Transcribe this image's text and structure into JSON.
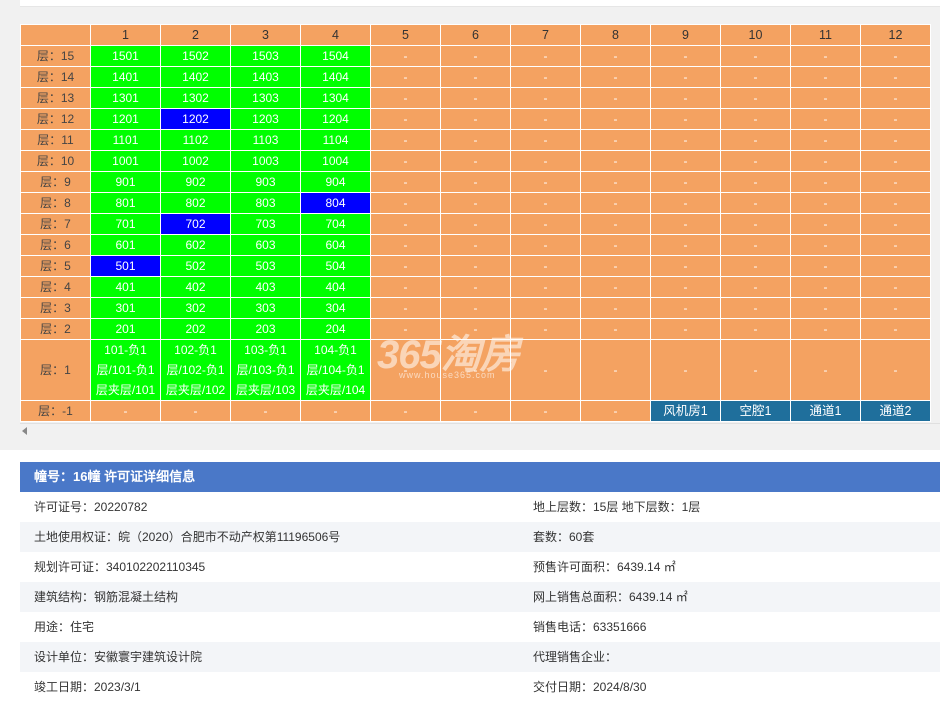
{
  "colors": {
    "available": "#00ff00",
    "sold": "#f4a261",
    "header": "#f4a261",
    "selected": "#0000ff",
    "special": "#1f6f9c",
    "detail_header": "#4a78c8"
  },
  "table": {
    "columns": [
      "1",
      "2",
      "3",
      "4",
      "5",
      "6",
      "7",
      "8",
      "9",
      "10",
      "11",
      "12"
    ],
    "rows": [
      {
        "floor": "层：15",
        "cells": [
          {
            "t": "1501",
            "s": "a"
          },
          {
            "t": "1502",
            "s": "a"
          },
          {
            "t": "1503",
            "s": "a"
          },
          {
            "t": "1504",
            "s": "a"
          },
          {
            "t": "-",
            "s": "n"
          },
          {
            "t": "-",
            "s": "n"
          },
          {
            "t": "-",
            "s": "n"
          },
          {
            "t": "-",
            "s": "n"
          },
          {
            "t": "-",
            "s": "n"
          },
          {
            "t": "-",
            "s": "n"
          },
          {
            "t": "-",
            "s": "n"
          },
          {
            "t": "-",
            "s": "n"
          }
        ]
      },
      {
        "floor": "层：14",
        "cells": [
          {
            "t": "1401",
            "s": "a"
          },
          {
            "t": "1402",
            "s": "a"
          },
          {
            "t": "1403",
            "s": "a"
          },
          {
            "t": "1404",
            "s": "a"
          },
          {
            "t": "-",
            "s": "n"
          },
          {
            "t": "-",
            "s": "n"
          },
          {
            "t": "-",
            "s": "n"
          },
          {
            "t": "-",
            "s": "n"
          },
          {
            "t": "-",
            "s": "n"
          },
          {
            "t": "-",
            "s": "n"
          },
          {
            "t": "-",
            "s": "n"
          },
          {
            "t": "-",
            "s": "n"
          }
        ]
      },
      {
        "floor": "层：13",
        "cells": [
          {
            "t": "1301",
            "s": "a"
          },
          {
            "t": "1302",
            "s": "a"
          },
          {
            "t": "1303",
            "s": "a"
          },
          {
            "t": "1304",
            "s": "a"
          },
          {
            "t": "-",
            "s": "n"
          },
          {
            "t": "-",
            "s": "n"
          },
          {
            "t": "-",
            "s": "n"
          },
          {
            "t": "-",
            "s": "n"
          },
          {
            "t": "-",
            "s": "n"
          },
          {
            "t": "-",
            "s": "n"
          },
          {
            "t": "-",
            "s": "n"
          },
          {
            "t": "-",
            "s": "n"
          }
        ]
      },
      {
        "floor": "层：12",
        "cells": [
          {
            "t": "1201",
            "s": "a"
          },
          {
            "t": "1202",
            "s": "b"
          },
          {
            "t": "1203",
            "s": "a"
          },
          {
            "t": "1204",
            "s": "a"
          },
          {
            "t": "-",
            "s": "n"
          },
          {
            "t": "-",
            "s": "n"
          },
          {
            "t": "-",
            "s": "n"
          },
          {
            "t": "-",
            "s": "n"
          },
          {
            "t": "-",
            "s": "n"
          },
          {
            "t": "-",
            "s": "n"
          },
          {
            "t": "-",
            "s": "n"
          },
          {
            "t": "-",
            "s": "n"
          }
        ]
      },
      {
        "floor": "层：11",
        "cells": [
          {
            "t": "1101",
            "s": "a"
          },
          {
            "t": "1102",
            "s": "a"
          },
          {
            "t": "1103",
            "s": "a"
          },
          {
            "t": "1104",
            "s": "a"
          },
          {
            "t": "-",
            "s": "n"
          },
          {
            "t": "-",
            "s": "n"
          },
          {
            "t": "-",
            "s": "n"
          },
          {
            "t": "-",
            "s": "n"
          },
          {
            "t": "-",
            "s": "n"
          },
          {
            "t": "-",
            "s": "n"
          },
          {
            "t": "-",
            "s": "n"
          },
          {
            "t": "-",
            "s": "n"
          }
        ]
      },
      {
        "floor": "层：10",
        "cells": [
          {
            "t": "1001",
            "s": "a"
          },
          {
            "t": "1002",
            "s": "a"
          },
          {
            "t": "1003",
            "s": "a"
          },
          {
            "t": "1004",
            "s": "a"
          },
          {
            "t": "-",
            "s": "n"
          },
          {
            "t": "-",
            "s": "n"
          },
          {
            "t": "-",
            "s": "n"
          },
          {
            "t": "-",
            "s": "n"
          },
          {
            "t": "-",
            "s": "n"
          },
          {
            "t": "-",
            "s": "n"
          },
          {
            "t": "-",
            "s": "n"
          },
          {
            "t": "-",
            "s": "n"
          }
        ]
      },
      {
        "floor": "层：9",
        "cells": [
          {
            "t": "901",
            "s": "a"
          },
          {
            "t": "902",
            "s": "a"
          },
          {
            "t": "903",
            "s": "a"
          },
          {
            "t": "904",
            "s": "a"
          },
          {
            "t": "-",
            "s": "n"
          },
          {
            "t": "-",
            "s": "n"
          },
          {
            "t": "-",
            "s": "n"
          },
          {
            "t": "-",
            "s": "n"
          },
          {
            "t": "-",
            "s": "n"
          },
          {
            "t": "-",
            "s": "n"
          },
          {
            "t": "-",
            "s": "n"
          },
          {
            "t": "-",
            "s": "n"
          }
        ]
      },
      {
        "floor": "层：8",
        "cells": [
          {
            "t": "801",
            "s": "a"
          },
          {
            "t": "802",
            "s": "a"
          },
          {
            "t": "803",
            "s": "a"
          },
          {
            "t": "804",
            "s": "b"
          },
          {
            "t": "-",
            "s": "n"
          },
          {
            "t": "-",
            "s": "n"
          },
          {
            "t": "-",
            "s": "n"
          },
          {
            "t": "-",
            "s": "n"
          },
          {
            "t": "-",
            "s": "n"
          },
          {
            "t": "-",
            "s": "n"
          },
          {
            "t": "-",
            "s": "n"
          },
          {
            "t": "-",
            "s": "n"
          }
        ]
      },
      {
        "floor": "层：7",
        "cells": [
          {
            "t": "701",
            "s": "a"
          },
          {
            "t": "702",
            "s": "b"
          },
          {
            "t": "703",
            "s": "a"
          },
          {
            "t": "704",
            "s": "a"
          },
          {
            "t": "-",
            "s": "n"
          },
          {
            "t": "-",
            "s": "n"
          },
          {
            "t": "-",
            "s": "n"
          },
          {
            "t": "-",
            "s": "n"
          },
          {
            "t": "-",
            "s": "n"
          },
          {
            "t": "-",
            "s": "n"
          },
          {
            "t": "-",
            "s": "n"
          },
          {
            "t": "-",
            "s": "n"
          }
        ]
      },
      {
        "floor": "层：6",
        "cells": [
          {
            "t": "601",
            "s": "a"
          },
          {
            "t": "602",
            "s": "a"
          },
          {
            "t": "603",
            "s": "a"
          },
          {
            "t": "604",
            "s": "a"
          },
          {
            "t": "-",
            "s": "n"
          },
          {
            "t": "-",
            "s": "n"
          },
          {
            "t": "-",
            "s": "n"
          },
          {
            "t": "-",
            "s": "n"
          },
          {
            "t": "-",
            "s": "n"
          },
          {
            "t": "-",
            "s": "n"
          },
          {
            "t": "-",
            "s": "n"
          },
          {
            "t": "-",
            "s": "n"
          }
        ]
      },
      {
        "floor": "层：5",
        "cells": [
          {
            "t": "501",
            "s": "b"
          },
          {
            "t": "502",
            "s": "a"
          },
          {
            "t": "503",
            "s": "a"
          },
          {
            "t": "504",
            "s": "a"
          },
          {
            "t": "-",
            "s": "n"
          },
          {
            "t": "-",
            "s": "n"
          },
          {
            "t": "-",
            "s": "n"
          },
          {
            "t": "-",
            "s": "n"
          },
          {
            "t": "-",
            "s": "n"
          },
          {
            "t": "-",
            "s": "n"
          },
          {
            "t": "-",
            "s": "n"
          },
          {
            "t": "-",
            "s": "n"
          }
        ]
      },
      {
        "floor": "层：4",
        "cells": [
          {
            "t": "401",
            "s": "a"
          },
          {
            "t": "402",
            "s": "a"
          },
          {
            "t": "403",
            "s": "a"
          },
          {
            "t": "404",
            "s": "a"
          },
          {
            "t": "-",
            "s": "n"
          },
          {
            "t": "-",
            "s": "n"
          },
          {
            "t": "-",
            "s": "n"
          },
          {
            "t": "-",
            "s": "n"
          },
          {
            "t": "-",
            "s": "n"
          },
          {
            "t": "-",
            "s": "n"
          },
          {
            "t": "-",
            "s": "n"
          },
          {
            "t": "-",
            "s": "n"
          }
        ]
      },
      {
        "floor": "层：3",
        "cells": [
          {
            "t": "301",
            "s": "a"
          },
          {
            "t": "302",
            "s": "a"
          },
          {
            "t": "303",
            "s": "a"
          },
          {
            "t": "304",
            "s": "a"
          },
          {
            "t": "-",
            "s": "n"
          },
          {
            "t": "-",
            "s": "n"
          },
          {
            "t": "-",
            "s": "n"
          },
          {
            "t": "-",
            "s": "n"
          },
          {
            "t": "-",
            "s": "n"
          },
          {
            "t": "-",
            "s": "n"
          },
          {
            "t": "-",
            "s": "n"
          },
          {
            "t": "-",
            "s": "n"
          }
        ]
      },
      {
        "floor": "层：2",
        "cells": [
          {
            "t": "201",
            "s": "a"
          },
          {
            "t": "202",
            "s": "a"
          },
          {
            "t": "203",
            "s": "a"
          },
          {
            "t": "204",
            "s": "a"
          },
          {
            "t": "-",
            "s": "n"
          },
          {
            "t": "-",
            "s": "n"
          },
          {
            "t": "-",
            "s": "n"
          },
          {
            "t": "-",
            "s": "n"
          },
          {
            "t": "-",
            "s": "n"
          },
          {
            "t": "-",
            "s": "n"
          },
          {
            "t": "-",
            "s": "n"
          },
          {
            "t": "-",
            "s": "n"
          }
        ]
      },
      {
        "floor": "层：1",
        "cells": [
          {
            "t": "101-负1层/101-负1层夹层/101",
            "s": "a"
          },
          {
            "t": "102-负1层/102-负1层夹层/102",
            "s": "a"
          },
          {
            "t": "103-负1层/103-负1层夹层/103",
            "s": "a"
          },
          {
            "t": "104-负1层/104-负1层夹层/104",
            "s": "a"
          },
          {
            "t": "-",
            "s": "n"
          },
          {
            "t": "-",
            "s": "n"
          },
          {
            "t": "-",
            "s": "n"
          },
          {
            "t": "-",
            "s": "n"
          },
          {
            "t": "-",
            "s": "n"
          },
          {
            "t": "-",
            "s": "n"
          },
          {
            "t": "-",
            "s": "n"
          },
          {
            "t": "-",
            "s": "n"
          }
        ]
      },
      {
        "floor": "层：-1",
        "cells": [
          {
            "t": "-",
            "s": "n"
          },
          {
            "t": "-",
            "s": "n"
          },
          {
            "t": "-",
            "s": "n"
          },
          {
            "t": "-",
            "s": "n"
          },
          {
            "t": "-",
            "s": "n"
          },
          {
            "t": "-",
            "s": "n"
          },
          {
            "t": "-",
            "s": "n"
          },
          {
            "t": "-",
            "s": "n"
          },
          {
            "t": "风机房1",
            "s": "s"
          },
          {
            "t": "空腔1",
            "s": "s"
          },
          {
            "t": "通道1",
            "s": "s"
          },
          {
            "t": "通道2",
            "s": "s"
          }
        ]
      }
    ]
  },
  "watermark": {
    "logo": "365淘房",
    "site": "www.house365.com"
  },
  "detail": {
    "title": "幢号：16幢 许可证详细信息",
    "rows": [
      {
        "left": "许可证号：20220782",
        "right": "地上层数：15层  地下层数：1层"
      },
      {
        "left": "土地使用权证：皖（2020）合肥市不动产权第11196506号",
        "right": "套数：60套"
      },
      {
        "left": "规划许可证：340102202110345",
        "right": "预售许可面积：6439.14 ㎡"
      },
      {
        "left": "建筑结构：钢筋混凝土结构",
        "right": "网上销售总面积：6439.14 ㎡"
      },
      {
        "left": "用途：住宅",
        "right": "销售电话：63351666"
      },
      {
        "left": "设计单位：安徽寰宇建筑设计院",
        "right": "代理销售企业："
      },
      {
        "left": "竣工日期：2023/3/1",
        "right": "交付日期：2024/8/30"
      }
    ]
  }
}
